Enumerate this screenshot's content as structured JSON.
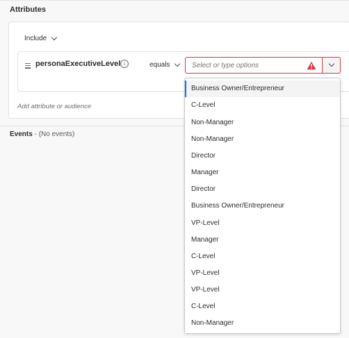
{
  "section": {
    "title": "Attributes"
  },
  "include": {
    "label": "Include"
  },
  "rule": {
    "attribute": "personaExecutiveLevel",
    "operator": "equals",
    "value_placeholder": "Select or type options",
    "status": "error"
  },
  "add_attribute": "Add attribute or audience",
  "events": {
    "title": "Events",
    "separator": " - ",
    "empty_text": "(No events)"
  },
  "dropdown": {
    "options": [
      "Business Owner/Entrepreneur",
      "C-Level",
      "Non-Manager",
      "Non-Manager",
      "Director",
      "Manager",
      "Director",
      "Business Owner/Entrepreneur",
      "VP-Level",
      "Manager",
      "C-Level",
      "VP-Level",
      "VP-Level",
      "C-Level",
      "Non-Manager"
    ]
  },
  "colors": {
    "error": "#d7373f",
    "focus": "#1473e6"
  }
}
